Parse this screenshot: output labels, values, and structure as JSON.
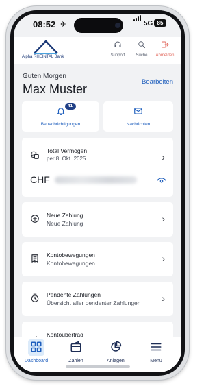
{
  "status_bar": {
    "time": "08:52",
    "network": "5G",
    "battery": "85"
  },
  "header": {
    "logo_text": "Alpha RHEINTAL Bank",
    "actions": [
      {
        "label": "Support",
        "icon": "headset-icon"
      },
      {
        "label": "Suche",
        "icon": "search-icon"
      },
      {
        "label": "Abmelden",
        "icon": "logout-icon",
        "color": "#e26a5f"
      }
    ]
  },
  "greeting": {
    "salutation": "Guten Morgen",
    "name": "Max Muster",
    "edit_label": "Bearbeiten"
  },
  "quick_actions": [
    {
      "label": "Benachrichtigungen",
      "icon": "bell-icon",
      "badge": "41"
    },
    {
      "label": "Nachrichten",
      "icon": "mail-icon"
    }
  ],
  "assets": {
    "title": "Total Vermögen",
    "date": "per 8. Okt. 2025",
    "currency": "CHF",
    "icon": "coins-icon",
    "amount_hidden": true
  },
  "menu_items": [
    {
      "title": "Neue Zahlung",
      "subtitle": "Neue Zahlung",
      "icon": "plus-circle-icon"
    },
    {
      "title": "Kontobewegungen",
      "subtitle": "Kontobewegungen",
      "icon": "receipt-icon"
    },
    {
      "title": "Pendente Zahlungen",
      "subtitle": "Übersicht aller pendenter Zahlungen",
      "icon": "timer-icon"
    },
    {
      "title": "Kontoübertrag",
      "subtitle": "",
      "icon": "transfer-icon"
    }
  ],
  "bottom_nav": [
    {
      "label": "Dashboard",
      "icon": "dashboard-icon",
      "active": true
    },
    {
      "label": "Zahlen",
      "icon": "wallet-icon"
    },
    {
      "label": "Anlagen",
      "icon": "pie-chart-icon"
    },
    {
      "label": "Menu",
      "icon": "hamburger-icon"
    }
  ],
  "colors": {
    "accent": "#1f5fbd",
    "brand": "#1d3a78",
    "badge": "#1f3f86",
    "logout": "#e26a5f",
    "background": "#f1f2f4"
  }
}
